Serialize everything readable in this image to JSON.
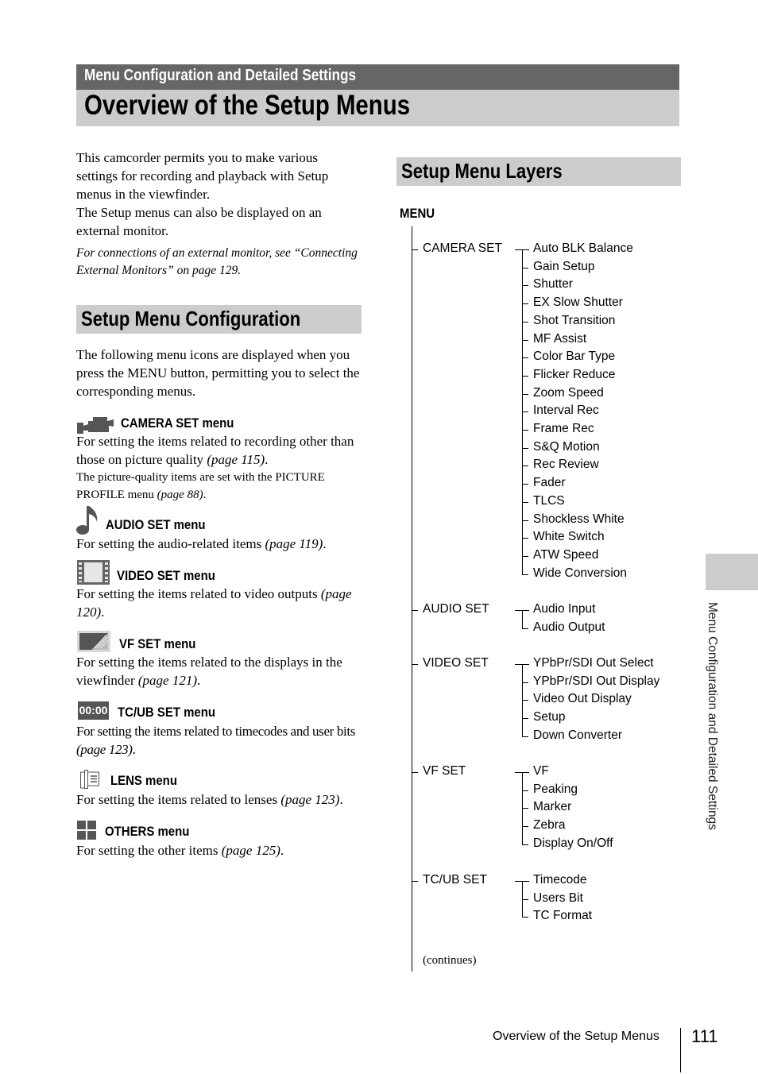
{
  "header": {
    "chapter": "Menu Configuration and Detailed Settings",
    "title": "Overview of the Setup Menus"
  },
  "intro": {
    "para1": "This camcorder permits you to make various settings for recording and playback with Setup menus in the viewfinder.",
    "para2": "The Setup menus can also be displayed on an external monitor.",
    "note": "For connections of an external monitor, see “Connecting External Monitors” on page 129."
  },
  "config_section": {
    "title": "Setup Menu Configuration",
    "intro": "The following menu icons are displayed when you press the MENU button, permitting you to select the corresponding menus.",
    "menus": [
      {
        "icon": "camera-icon",
        "title": "CAMERA SET menu",
        "desc": "For setting the items related to recording other than those on picture quality",
        "page_ref": "(page 115)",
        "extra": "The picture-quality items are set with the PICTURE PROFILE menu",
        "extra_ref": "(page 88)"
      },
      {
        "icon": "music-note-icon",
        "title": "AUDIO SET menu",
        "desc": "For setting the audio-related items",
        "page_ref": "(page 119)"
      },
      {
        "icon": "film-strip-icon",
        "title": "VIDEO SET menu",
        "desc": "For setting the items related to video outputs",
        "page_ref": "(page 120)"
      },
      {
        "icon": "viewfinder-icon",
        "title": "VF SET menu",
        "desc": "For setting the items related to the displays in the viewfinder",
        "page_ref": "(page 121)"
      },
      {
        "icon": "timecode-icon",
        "icon_text": "00:00",
        "title": "TC/UB SET menu",
        "desc": "For setting the items related to timecodes and user bits",
        "page_ref": "(page 123)"
      },
      {
        "icon": "lens-icon",
        "title": "LENS menu",
        "desc": "For setting the items related to lenses",
        "page_ref": "(page 123)"
      },
      {
        "icon": "others-grid-icon",
        "title": "OTHERS menu",
        "desc": "For setting the other items",
        "page_ref": "(page 125)"
      }
    ]
  },
  "layers_section": {
    "title": "Setup Menu Layers",
    "root": "MENU",
    "groups": [
      {
        "name": "CAMERA SET",
        "items": [
          "Auto BLK Balance",
          "Gain Setup",
          "Shutter",
          "EX Slow Shutter",
          "Shot Transition",
          "MF Assist",
          "Color Bar Type",
          "Flicker Reduce",
          "Zoom Speed",
          "Interval Rec",
          "Frame Rec",
          "S&Q Motion",
          "Rec Review",
          "Fader",
          "TLCS",
          "Shockless White",
          "White Switch",
          "ATW Speed",
          "Wide Conversion"
        ]
      },
      {
        "name": "AUDIO SET",
        "items": [
          "Audio Input",
          "Audio Output"
        ]
      },
      {
        "name": "VIDEO SET",
        "items": [
          "YPbPr/SDI Out Select",
          "YPbPr/SDI Out Display",
          "Video Out Display",
          "Setup",
          "Down Converter"
        ]
      },
      {
        "name": "VF SET",
        "items": [
          "VF",
          "Peaking",
          "Marker",
          "Zebra",
          "Display On/Off"
        ]
      },
      {
        "name": "TC/UB SET",
        "items": [
          "Timecode",
          "Users Bit",
          "TC Format"
        ]
      }
    ],
    "continues": "(continues)"
  },
  "side_tab": "Menu Configuration and Detailed Settings",
  "footer": {
    "title": "Overview of the Setup Menus",
    "page": "111"
  }
}
